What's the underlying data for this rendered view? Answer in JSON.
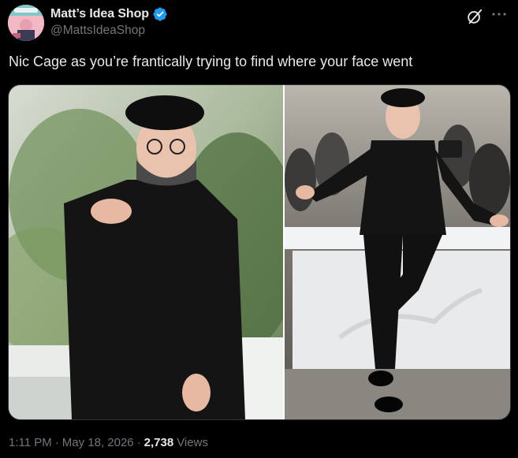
{
  "author": {
    "display_name": "Matt’s Idea Shop",
    "handle": "@MattsIdeaShop",
    "verified_icon": "verified-badge-icon",
    "accent": "#1d9bf0"
  },
  "actions": {
    "grok_icon": "grok-icon",
    "more_icon": "more-options-icon"
  },
  "post": {
    "text": "Nic Cage as you’re frantically trying to find where your face went"
  },
  "media": {
    "image_count": 2
  },
  "meta": {
    "time": "1:11 PM",
    "sep1": "·",
    "date": "May 18, 2026",
    "sep2": "·",
    "views_count": "2,738",
    "views_label": "Views"
  }
}
